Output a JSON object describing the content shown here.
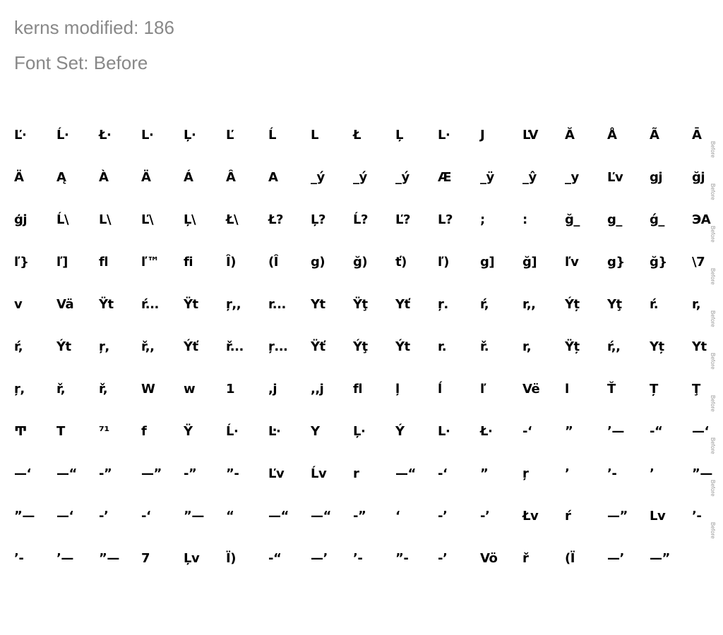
{
  "header": {
    "kerns_modified": "kerns modified: 186",
    "font_set": "Font Set: Before"
  },
  "row_tag": "Before",
  "rows": [
    [
      "Ľ·",
      "Ĺ·",
      "Ł·",
      "L·",
      "Ļ·",
      "Ľ",
      "Ĺ",
      "L",
      "Ł",
      "Ļ",
      "L·",
      "J",
      "ĽV",
      "Ă",
      "Å",
      "Ã",
      "Ā"
    ],
    [
      "Ä",
      "Ą",
      "À",
      "Ä",
      "Á",
      "Â",
      "A",
      "_ý",
      "_ý",
      "_ý",
      "Æ",
      "_ÿ",
      "_ŷ",
      "_y",
      "Ľv",
      "gj",
      "ğj"
    ],
    [
      "ģj",
      "Ĺ\\",
      "L\\",
      "Ľ\\",
      "Ļ\\",
      "Ł\\",
      "Ł?",
      "Ļ?",
      "Ĺ?",
      "Ľ?",
      "L?",
      ";",
      ":",
      "ğ_",
      "g_",
      "ǵ_",
      "ЭA"
    ],
    [
      "ľ}",
      "ľ]",
      "fl",
      "ľ™",
      "fi",
      "Î)",
      "(Î",
      "g)",
      "ğ)",
      "ť)",
      "ľ)",
      "g]",
      "ğ]",
      "ľv",
      "g}",
      "ğ}",
      "\\7"
    ],
    [
      "v",
      "Vä",
      "Ÿt",
      "ŕ...",
      "Ÿt",
      "ŗ,,",
      "r...",
      "Yt",
      "Ÿţ",
      "Yť",
      "ŗ.",
      "ŕ,",
      "r,,",
      "Ýț",
      "Yţ",
      "ŕ.",
      "r,"
    ],
    [
      "ŕ,",
      "Ýt",
      "ŗ,",
      "ř,,",
      "Ýť",
      "ř...",
      "ŗ...",
      "Ÿť",
      "Ýţ",
      "Ýt",
      "r.",
      "ř.",
      "r,",
      "Ÿț",
      "ŕ,,",
      "Yț",
      "Yt"
    ],
    [
      "ŗ,",
      "ř,",
      "ř,",
      "W",
      "w",
      "1",
      ",j",
      ",,j",
      "fl",
      "ļ",
      "ĺ",
      "ľ",
      "Vë",
      "l",
      "Ť",
      "Ț",
      "Ţ"
    ],
    [
      "Ͳ",
      "T",
      "⁷¹",
      "f",
      "Ÿ",
      "Ĺ·",
      "Ŀ·",
      "Y",
      "Ļ·",
      "Ý",
      "L·",
      "Ł·",
      "-‘",
      "”",
      "’—",
      "-“",
      "—‘"
    ],
    [
      "—‘",
      "—“",
      "-”",
      "—”",
      "-”",
      "”-",
      "Ľv",
      "Ĺv",
      "r",
      "—“",
      "-‘",
      "”",
      "ŗ",
      "’",
      "’-",
      "’",
      "”—"
    ],
    [
      "”—",
      "—‘",
      "-’",
      "-‘",
      "”—",
      "“",
      "—“",
      "—“",
      "-”",
      "‘",
      "-’",
      "-’",
      "Łv",
      "ŕ",
      "—”",
      "Lv",
      "’-"
    ],
    [
      "’-",
      "’—",
      "”—",
      "7",
      "Ļv",
      "Ï)",
      "-“",
      "—’",
      "’-",
      "”-",
      "-’",
      "Vö",
      "ř",
      "(Ï",
      "—’",
      "—”"
    ]
  ]
}
